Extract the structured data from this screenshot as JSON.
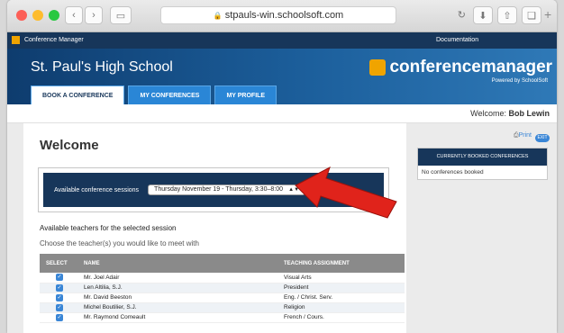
{
  "browser": {
    "url": "stpauls-win.schoolsoft.com"
  },
  "site": {
    "app_title": "Conference Manager",
    "documentation_link": "Documentation",
    "school_name": "St. Paul's High School",
    "logo_text": "conferencemanager",
    "powered_by": "Powered by SchoolSoft",
    "tabs": [
      {
        "label": "BOOK A CONFERENCE"
      },
      {
        "label": "MY CONFERENCES"
      },
      {
        "label": "MY PROFILE"
      }
    ],
    "welcome_prefix": "Welcome:",
    "user_name": "Bob Lewin"
  },
  "main": {
    "heading": "Welcome",
    "session_label": "Available conference sessions",
    "session_selected": "Thursday November 19 - Thursday, 3:30–8:00",
    "teachers_heading": "Available teachers for the selected session",
    "choose_text": "Choose the teacher(s) you would like to meet with",
    "table": {
      "headers": [
        "SELECT",
        "NAME",
        "TEACHING ASSIGNMENT"
      ],
      "rows": [
        {
          "name": "Mr. Joel Adair",
          "assignment": "Visual Arts"
        },
        {
          "name": "Len Altilia, S.J.",
          "assignment": "President"
        },
        {
          "name": "Mr. David Beeston",
          "assignment": "Eng. / Christ. Serv."
        },
        {
          "name": "Michel Boutilier, S.J.",
          "assignment": "Religion"
        },
        {
          "name": "Mr. Raymond Comeault",
          "assignment": "French / Cours."
        }
      ]
    }
  },
  "sidebar": {
    "print_label": "Print",
    "exit_label": "EXIT",
    "booked_title": "CURRENTLY BOOKED CONFERENCES",
    "booked_empty": "No conferences booked"
  },
  "colors": {
    "navy": "#17365a",
    "accent_blue": "#3a86d6",
    "annotation_arrow": "#e0231b"
  }
}
